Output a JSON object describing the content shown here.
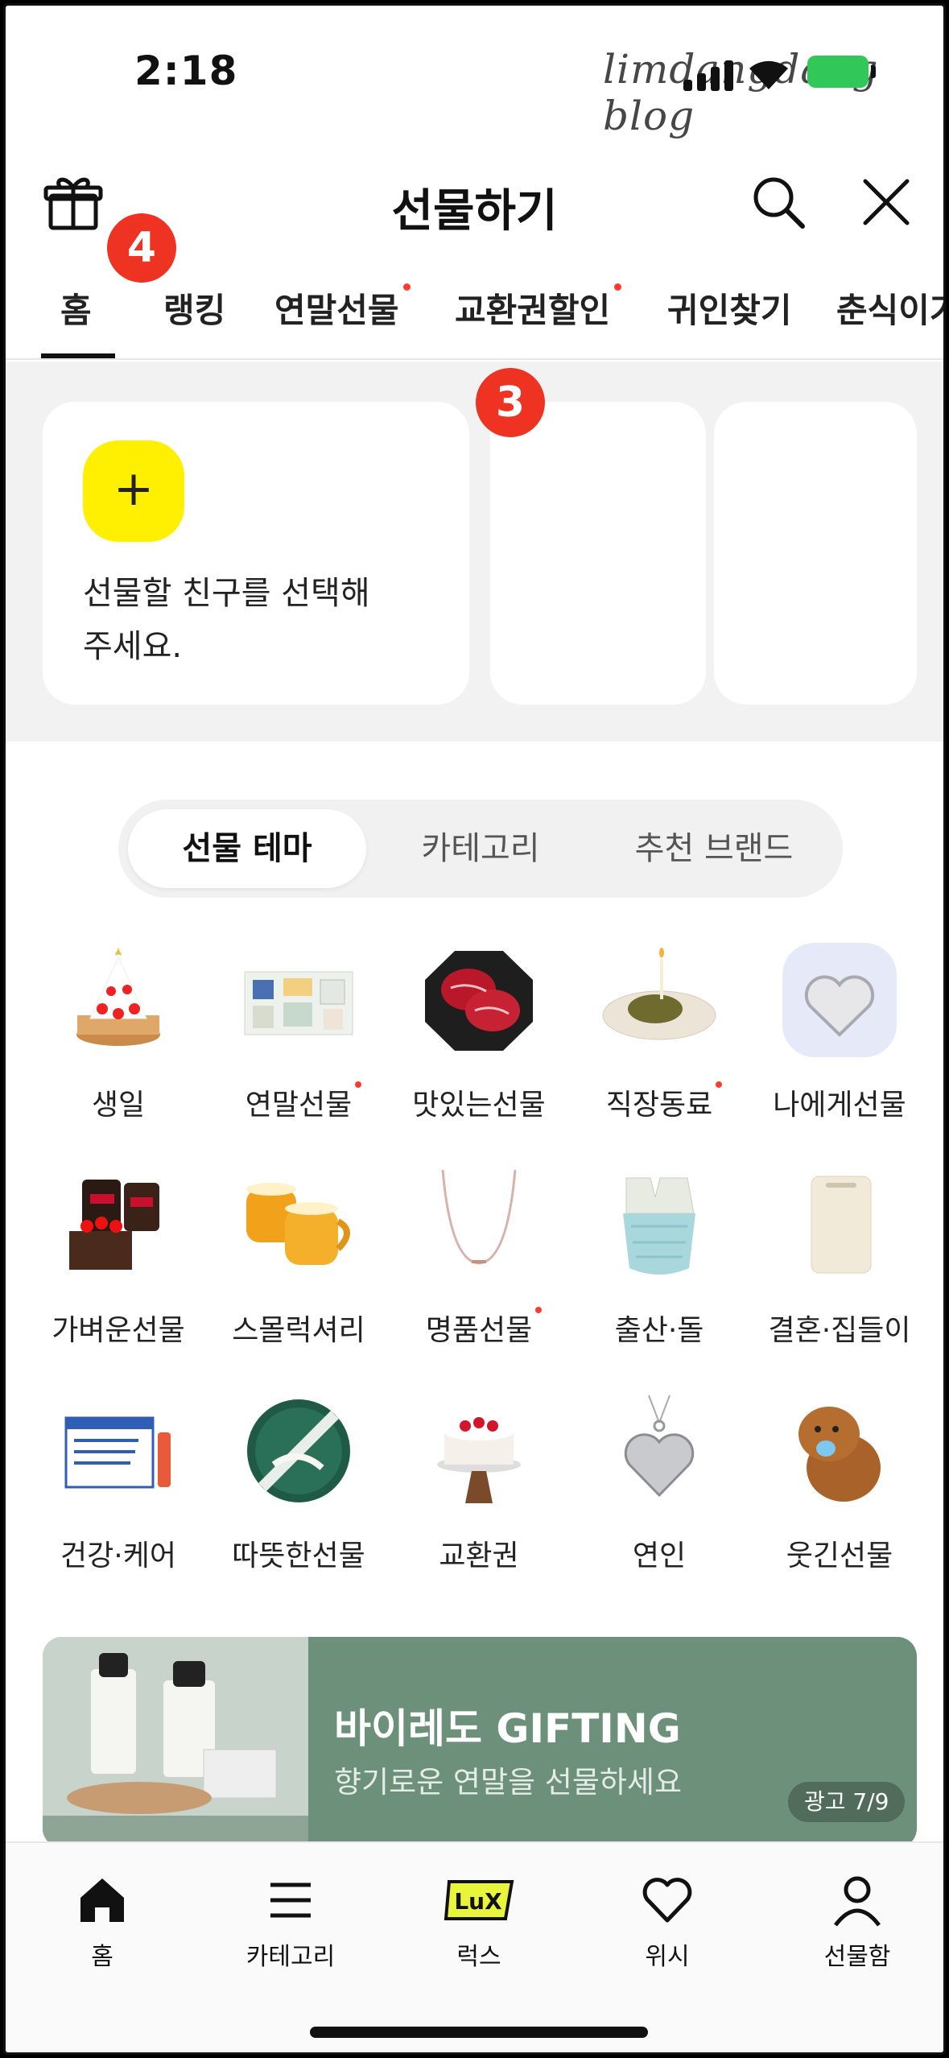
{
  "status": {
    "time": "2:18",
    "watermark": "limdangdang blog"
  },
  "header": {
    "title": "선물하기"
  },
  "tabs": [
    {
      "label": "홈",
      "dot": false
    },
    {
      "label": "랭킹",
      "dot": false
    },
    {
      "label": "연말선물",
      "dot": true
    },
    {
      "label": "교환권할인",
      "dot": true
    },
    {
      "label": "귀인찾기",
      "dot": false
    },
    {
      "label": "춘식이가",
      "dot": false
    }
  ],
  "badges": {
    "tabs": "4",
    "friends": "3"
  },
  "friend_picker": {
    "plus": "+",
    "line1": "선물할 친구를 선택해",
    "line2": "주세요."
  },
  "segment": {
    "items": [
      "선물 테마",
      "카테고리",
      "추천 브랜드"
    ],
    "selected": "선물 테마"
  },
  "themes": [
    {
      "label": "생일",
      "dot": false,
      "icon": "cake-icon"
    },
    {
      "label": "연말선물",
      "dot": true,
      "icon": "gift-set-icon"
    },
    {
      "label": "맛있는선물",
      "dot": false,
      "icon": "meat-icon"
    },
    {
      "label": "직장동료",
      "dot": true,
      "icon": "dessert-plate-icon"
    },
    {
      "label": "나에게선물",
      "dot": false,
      "icon": "heart-pendant-icon"
    },
    {
      "label": "가벼운선물",
      "dot": false,
      "icon": "coffee-cake-icon"
    },
    {
      "label": "스몰럭셔리",
      "dot": false,
      "icon": "mugs-icon"
    },
    {
      "label": "명품선물",
      "dot": true,
      "icon": "necklace-icon"
    },
    {
      "label": "출산·돌",
      "dot": false,
      "icon": "baby-clothes-icon"
    },
    {
      "label": "결혼·집들이",
      "dot": false,
      "icon": "appliance-icon"
    },
    {
      "label": "건강·케어",
      "dot": false,
      "icon": "supplement-icon"
    },
    {
      "label": "따뜻한선물",
      "dot": false,
      "icon": "tin-box-icon"
    },
    {
      "label": "교환권",
      "dot": false,
      "icon": "cake-stand-icon"
    },
    {
      "label": "연인",
      "dot": false,
      "icon": "silver-heart-icon"
    },
    {
      "label": "웃긴선물",
      "dot": false,
      "icon": "capybara-icon"
    }
  ],
  "banner": {
    "title": "바이레도 GIFTING",
    "subtitle": "향기로운 연말을 선물하세요",
    "pager": "광고 7/9"
  },
  "bottom_nav": [
    {
      "label": "홈",
      "icon": "home-icon"
    },
    {
      "label": "카테고리",
      "icon": "menu-icon"
    },
    {
      "label": "럭스",
      "icon": "lux-icon"
    },
    {
      "label": "위시",
      "icon": "heart-icon"
    },
    {
      "label": "선물함",
      "icon": "person-icon"
    }
  ],
  "colors": {
    "accent_yellow": "#fef000",
    "badge_red": "#ee3322",
    "banner_green": "#6d907a"
  }
}
